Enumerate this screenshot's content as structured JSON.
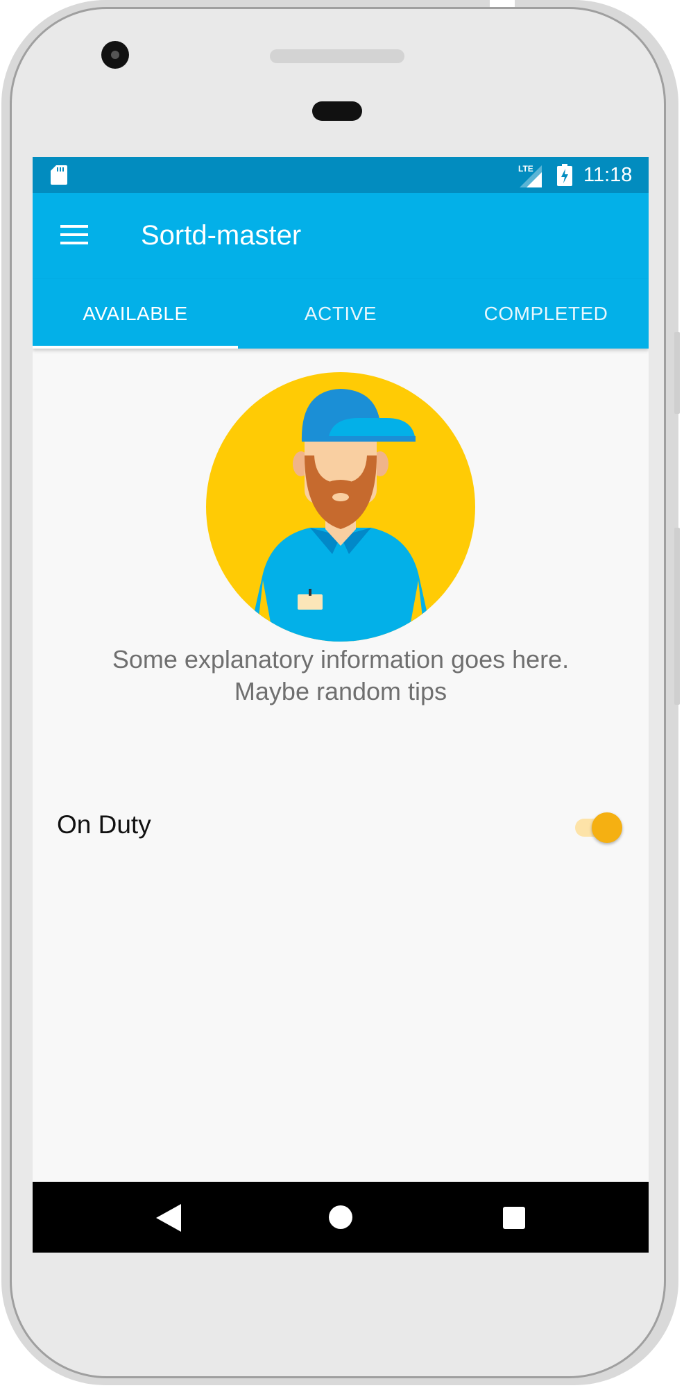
{
  "status_bar": {
    "time": "11:18",
    "network": "LTE",
    "icons": [
      "sd-card-icon",
      "lte-signal-icon",
      "battery-charging-icon"
    ]
  },
  "toolbar": {
    "title": "Sortd-master",
    "menu_icon": "hamburger-menu-icon"
  },
  "tabs": [
    {
      "label": "AVAILABLE",
      "selected": true
    },
    {
      "label": "ACTIVE",
      "selected": false
    },
    {
      "label": "COMPLETED",
      "selected": false
    }
  ],
  "main": {
    "avatar_icon": "courier-avatar-icon",
    "info_text": "Some explanatory information goes here. Maybe random tips",
    "on_duty": {
      "label": "On Duty",
      "checked": true
    }
  },
  "nav_bar": {
    "icons": [
      "back-icon",
      "home-icon",
      "recents-icon"
    ]
  },
  "colors": {
    "status_bar": "#028cbf",
    "primary": "#03b0e8",
    "accent": "#f5b012",
    "avatar_bg": "#ffcb05"
  }
}
